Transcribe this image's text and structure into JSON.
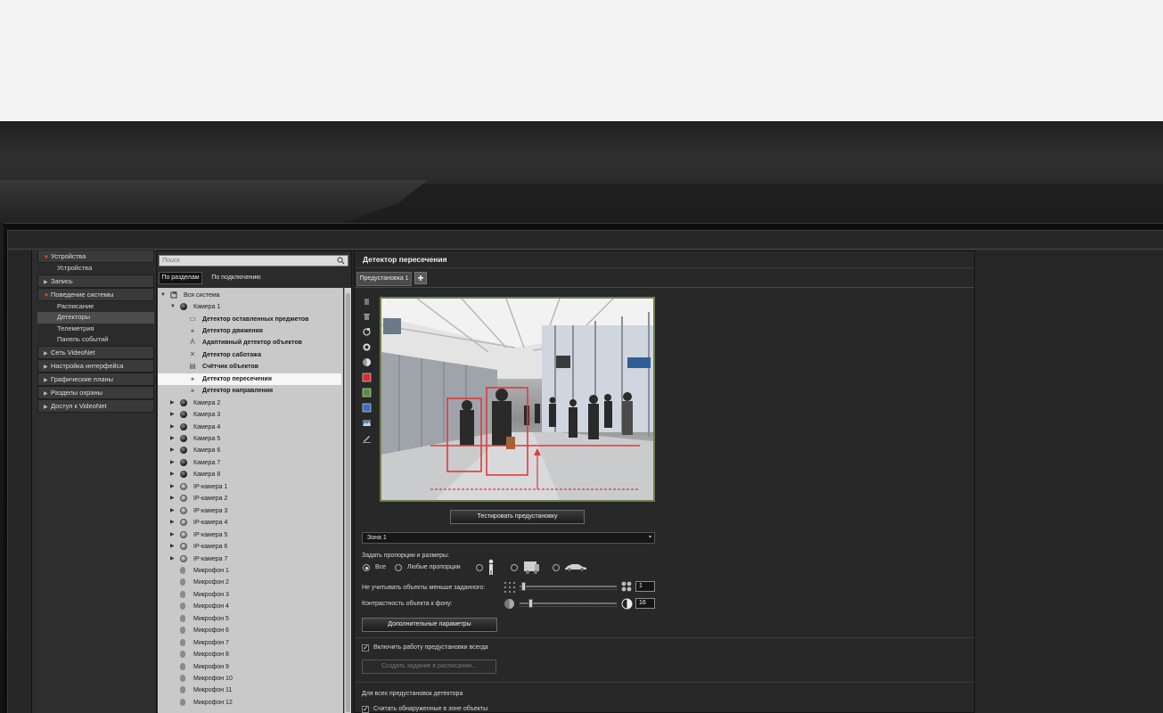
{
  "nav": {
    "devices_header": "Устройства",
    "devices_sub": "Устройства",
    "record": "Запись",
    "behavior_header": "Поведение системы",
    "schedule": "Расписание",
    "detectors": "Детекторы",
    "telemetry": "Телеметрия",
    "events_panel": "Панель событий",
    "videonet": "Сеть VideoNet",
    "interface": "Настройка интерфейса",
    "plans": "Графические планы",
    "security": "Разделы охраны",
    "access": "Доступ к VideoNet"
  },
  "tree_panel": {
    "search_placeholder": "Поиск",
    "tab_sections": "По разделам",
    "tab_connection": "По подключению",
    "root": "Вся система",
    "camera1": "Камера 1",
    "detectors": [
      "Детектор оставленных предметов",
      "Детектор движения",
      "Адаптивный детектор объектов",
      "Детектор саботажа",
      "Счётчик объектов",
      "Детектор пересечения",
      "Детектор направления"
    ],
    "cameras": [
      "Камера 2",
      "Камера 3",
      "Камера 4",
      "Камера 5",
      "Камера 6",
      "Камера 7",
      "Камера 8"
    ],
    "ip_cameras": [
      "IP-камера 1",
      "IP-камера 2",
      "IP-камера 3",
      "IP-камера 4",
      "IP-камера 5",
      "IP-камера 6",
      "IP-камера 7"
    ],
    "mics": [
      "Микрофон 1",
      "Микрофон 2",
      "Микрофон 3",
      "Микрофон 4",
      "Микрофон 5",
      "Микрофон 6",
      "Микрофон 7",
      "Микрофон 8",
      "Микрофон 9",
      "Микрофон 10",
      "Микрофон 11",
      "Микрофон 12"
    ]
  },
  "main": {
    "title": "Детектор пересечения",
    "preset_tab": "Предустановка 1",
    "add_symbol": "+",
    "video_index": "1",
    "test_button": "Тестировать предустановку",
    "zone_value": "Зона 1",
    "proportions_label": "Задать пропорции и размеры:",
    "radio_all": "Все",
    "radio_any": "Любые пропорции",
    "ignore_small_label": "Не учитывать объекты меньше заданного:",
    "ignore_small_value": "1",
    "ignore_small_level": 0.02,
    "contrast_label": "Контрастность объекта к фону:",
    "contrast_value": "16",
    "contrast_level": 0.06,
    "advanced_button": "Дополнительные параметры",
    "always_on_label": "Включить работу предустановки всегда",
    "schedule_button": "Создать задание в расписании...",
    "all_presets_label": "Для всех предустановок детектора",
    "count_in_zone_label": "Считать обнаруженные в зоне объекты",
    "check_mark": "✓"
  },
  "colors": {
    "accent_arrow": "#e2622b",
    "zone_red": "#e23a3a",
    "video_border": "#6f7f4e"
  }
}
